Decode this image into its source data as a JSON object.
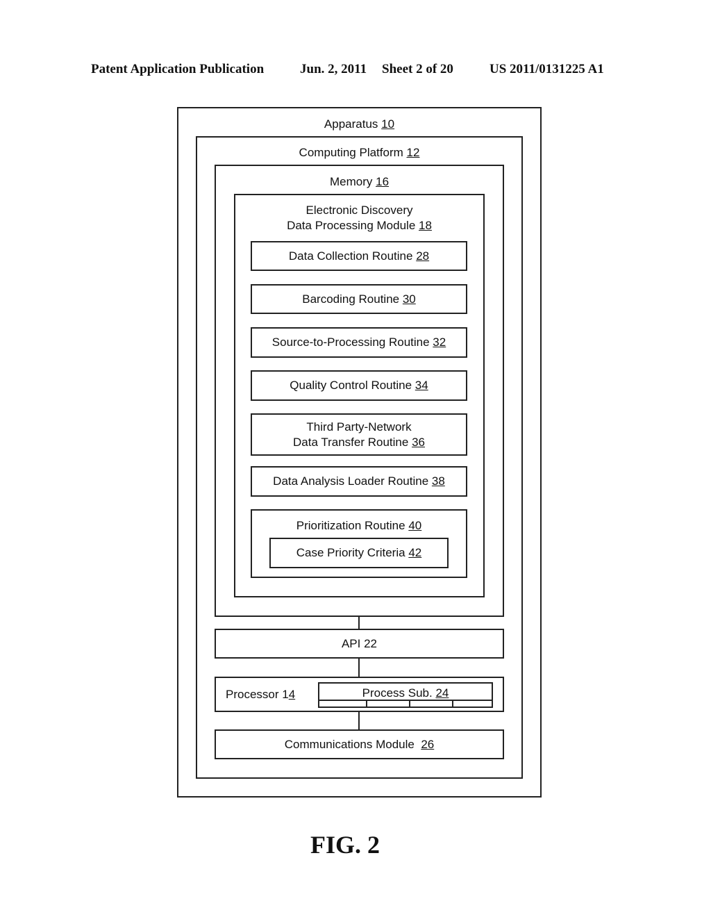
{
  "header": {
    "publication": "Patent Application Publication",
    "date": "Jun. 2, 2011",
    "sheet": "Sheet 2 of 20",
    "patent_number": "US 2011/0131225 A1"
  },
  "diagram": {
    "apparatus": {
      "name": "Apparatus",
      "ref": "10"
    },
    "computing_platform": {
      "name": "Computing Platform",
      "ref": "12"
    },
    "memory": {
      "name": "Memory",
      "ref": "16"
    },
    "module": {
      "line1": "Electronic Discovery",
      "line2": "Data Processing Module",
      "ref": "18"
    },
    "routines": [
      {
        "name": "Data Collection Routine",
        "ref": "28"
      },
      {
        "name": "Barcoding Routine",
        "ref": "30"
      },
      {
        "name": "Source-to-Processing Routine",
        "ref": "32"
      },
      {
        "name": "Quality Control Routine",
        "ref": "34"
      },
      {
        "line1": "Third Party-Network",
        "name": "Data Transfer Routine",
        "ref": "36"
      },
      {
        "name": "Data Analysis Loader Routine",
        "ref": "38"
      },
      {
        "name": "Prioritization Routine",
        "ref": "40"
      }
    ],
    "criteria": {
      "name": "Case Priority Criteria",
      "ref": "42"
    },
    "api": {
      "name": "API 22"
    },
    "processor": {
      "name": "Processor 1",
      "ref": "4"
    },
    "process_sub": {
      "name": "Process Sub.",
      "ref": "24"
    },
    "communications": {
      "name": "Communications Module",
      "ref": "26"
    }
  },
  "figure_label": "FIG. 2"
}
